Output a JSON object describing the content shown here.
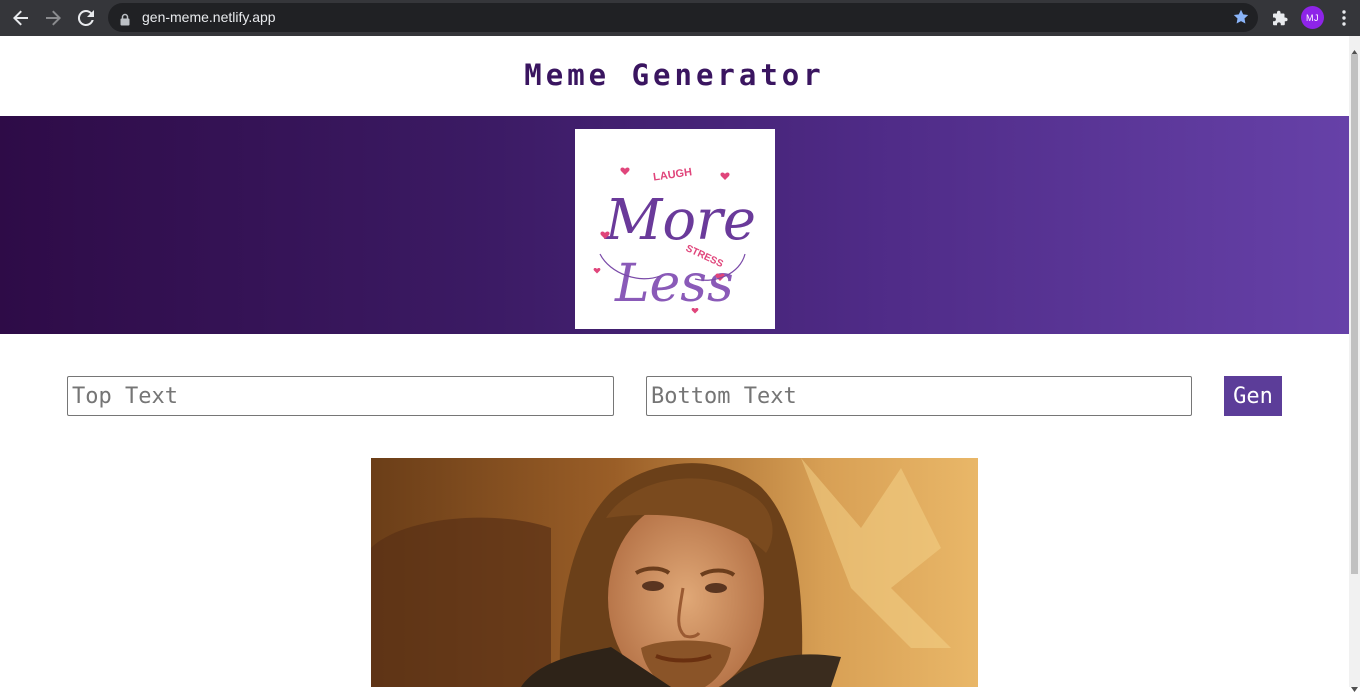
{
  "browser": {
    "url": "gen-meme.netlify.app",
    "avatar_initials": "MJ",
    "accent_color": "#8ab4f8"
  },
  "header": {
    "title": "Meme Generator"
  },
  "banner": {
    "logo_words": [
      "LAUGH",
      "More",
      "STRESS",
      "Less"
    ],
    "gradient": [
      "#2e0b47",
      "#6641a8"
    ]
  },
  "form": {
    "top_text": {
      "value": "",
      "placeholder": "Top Text"
    },
    "bottom_text": {
      "value": "",
      "placeholder": "Bottom Text"
    },
    "generate_label": "Gen"
  },
  "meme": {
    "alt": "One does not simply meme image"
  }
}
